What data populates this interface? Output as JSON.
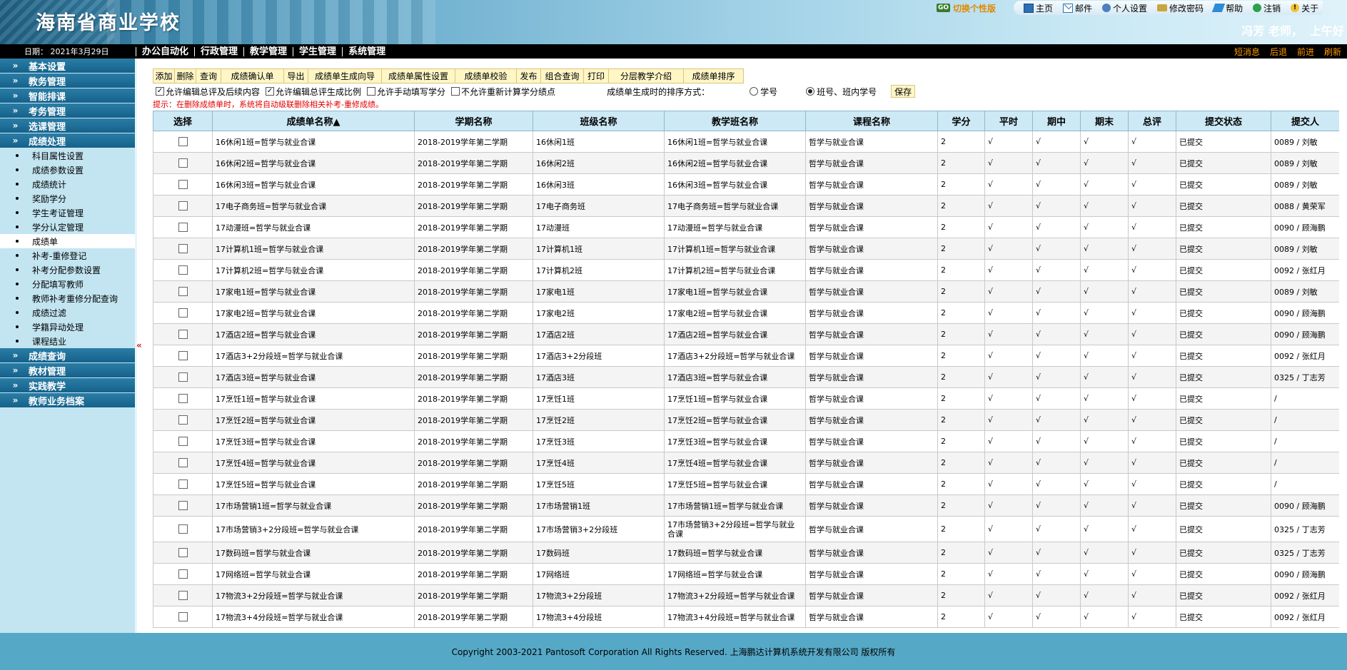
{
  "header": {
    "school_title": "海南省商业学校",
    "switch_badge": "GO",
    "switch_label": "切换个性版",
    "greeting_name": "冯芳 老师，",
    "greeting_time": "上午好"
  },
  "topnav": [
    {
      "icon": "home-icon",
      "label": "主页"
    },
    {
      "icon": "mail-icon",
      "label": "邮件"
    },
    {
      "icon": "user-settings-icon",
      "label": "个人设置"
    },
    {
      "icon": "key-icon",
      "label": "修改密码"
    },
    {
      "icon": "help-icon",
      "label": "帮助"
    },
    {
      "icon": "logout-icon",
      "label": "注销"
    },
    {
      "icon": "info-icon",
      "label": "关于"
    }
  ],
  "menubar": {
    "date": "日期： 2021年3月29日",
    "items": [
      "办公自动化",
      "行政管理",
      "教学管理",
      "学生管理",
      "系统管理"
    ],
    "right": [
      "短消息",
      "后退",
      "前进",
      "刷新"
    ]
  },
  "sidebar": {
    "groups_top": [
      "基本设置",
      "教务管理",
      "智能排课",
      "考务管理",
      "选课管理",
      "成绩处理"
    ],
    "subitems": [
      "科目属性设置",
      "成绩参数设置",
      "成绩统计",
      "奖励学分",
      "学生考证管理",
      "学分认定管理",
      "成绩单",
      "补考-重修登记",
      "补考分配参数设置",
      "分配填写教师",
      "教师补考重修分配查询",
      "成绩过滤",
      "学籍异动处理",
      "课程结业"
    ],
    "active_sub": 6,
    "groups_bottom": [
      "成绩查询",
      "教材管理",
      "实践教学",
      "教师业务档案"
    ],
    "collapse": "«"
  },
  "toolbar": {
    "buttons": [
      "添加",
      "删除",
      "查询",
      "成绩确认单",
      "导出",
      "成绩单生成向导",
      "成绩单属性设置",
      "成绩单校验",
      "发布",
      "组合查询",
      "打印",
      "分层教学介绍",
      "成绩单排序"
    ]
  },
  "options": {
    "cb1": "允许编辑总评及后续内容",
    "cb2": "允许编辑总评生成比例",
    "cb3": "允许手动填写学分",
    "cb4": "不允许重新计算学分绩点",
    "sort_label": "成绩单生成时的排序方式：",
    "radio1": "学号",
    "radio2": "班号、班内学号",
    "save": "保存",
    "tip": "提示：在删除成绩单时，系统将自动级联删除相关补考-重修成绩。"
  },
  "table": {
    "headers": [
      "选择",
      "成绩单名称▲",
      "学期名称",
      "班级名称",
      "教学班名称",
      "课程名称",
      "学分",
      "平时",
      "期中",
      "期末",
      "总评",
      "提交状态",
      "提交人"
    ],
    "rows": [
      [
        "16休闲1班=哲学与就业合课",
        "2018-2019学年第二学期",
        "16休闲1班",
        "16休闲1班=哲学与就业合课",
        "哲学与就业合课",
        "2",
        "√",
        "√",
        "√",
        "√",
        "已提交",
        "0089 / 刘敏"
      ],
      [
        "16休闲2班=哲学与就业合课",
        "2018-2019学年第二学期",
        "16休闲2班",
        "16休闲2班=哲学与就业合课",
        "哲学与就业合课",
        "2",
        "√",
        "√",
        "√",
        "√",
        "已提交",
        "0089 / 刘敏"
      ],
      [
        "16休闲3班=哲学与就业合课",
        "2018-2019学年第二学期",
        "16休闲3班",
        "16休闲3班=哲学与就业合课",
        "哲学与就业合课",
        "2",
        "√",
        "√",
        "√",
        "√",
        "已提交",
        "0089 / 刘敏"
      ],
      [
        "17电子商务班=哲学与就业合课",
        "2018-2019学年第二学期",
        "17电子商务班",
        "17电子商务班=哲学与就业合课",
        "哲学与就业合课",
        "2",
        "√",
        "√",
        "√",
        "√",
        "已提交",
        "0088 / 黄荣军"
      ],
      [
        "17动漫班=哲学与就业合课",
        "2018-2019学年第二学期",
        "17动漫班",
        "17动漫班=哲学与就业合课",
        "哲学与就业合课",
        "2",
        "√",
        "√",
        "√",
        "√",
        "已提交",
        "0090 / 顾海鹏"
      ],
      [
        "17计算机1班=哲学与就业合课",
        "2018-2019学年第二学期",
        "17计算机1班",
        "17计算机1班=哲学与就业合课",
        "哲学与就业合课",
        "2",
        "√",
        "√",
        "√",
        "√",
        "已提交",
        "0089 / 刘敏"
      ],
      [
        "17计算机2班=哲学与就业合课",
        "2018-2019学年第二学期",
        "17计算机2班",
        "17计算机2班=哲学与就业合课",
        "哲学与就业合课",
        "2",
        "√",
        "√",
        "√",
        "√",
        "已提交",
        "0092 / 张红月"
      ],
      [
        "17家电1班=哲学与就业合课",
        "2018-2019学年第二学期",
        "17家电1班",
        "17家电1班=哲学与就业合课",
        "哲学与就业合课",
        "2",
        "√",
        "√",
        "√",
        "√",
        "已提交",
        "0089 / 刘敏"
      ],
      [
        "17家电2班=哲学与就业合课",
        "2018-2019学年第二学期",
        "17家电2班",
        "17家电2班=哲学与就业合课",
        "哲学与就业合课",
        "2",
        "√",
        "√",
        "√",
        "√",
        "已提交",
        "0090 / 顾海鹏"
      ],
      [
        "17酒店2班=哲学与就业合课",
        "2018-2019学年第二学期",
        "17酒店2班",
        "17酒店2班=哲学与就业合课",
        "哲学与就业合课",
        "2",
        "√",
        "√",
        "√",
        "√",
        "已提交",
        "0090 / 顾海鹏"
      ],
      [
        "17酒店3+2分段班=哲学与就业合课",
        "2018-2019学年第二学期",
        "17酒店3+2分段班",
        "17酒店3+2分段班=哲学与就业合课",
        "哲学与就业合课",
        "2",
        "√",
        "√",
        "√",
        "√",
        "已提交",
        "0092 / 张红月"
      ],
      [
        "17酒店3班=哲学与就业合课",
        "2018-2019学年第二学期",
        "17酒店3班",
        "17酒店3班=哲学与就业合课",
        "哲学与就业合课",
        "2",
        "√",
        "√",
        "√",
        "√",
        "已提交",
        "0325 / 丁志芳"
      ],
      [
        "17烹饪1班=哲学与就业合课",
        "2018-2019学年第二学期",
        "17烹饪1班",
        "17烹饪1班=哲学与就业合课",
        "哲学与就业合课",
        "2",
        "√",
        "√",
        "√",
        "√",
        "已提交",
        "/"
      ],
      [
        "17烹饪2班=哲学与就业合课",
        "2018-2019学年第二学期",
        "17烹饪2班",
        "17烹饪2班=哲学与就业合课",
        "哲学与就业合课",
        "2",
        "√",
        "√",
        "√",
        "√",
        "已提交",
        "/"
      ],
      [
        "17烹饪3班=哲学与就业合课",
        "2018-2019学年第二学期",
        "17烹饪3班",
        "17烹饪3班=哲学与就业合课",
        "哲学与就业合课",
        "2",
        "√",
        "√",
        "√",
        "√",
        "已提交",
        "/"
      ],
      [
        "17烹饪4班=哲学与就业合课",
        "2018-2019学年第二学期",
        "17烹饪4班",
        "17烹饪4班=哲学与就业合课",
        "哲学与就业合课",
        "2",
        "√",
        "√",
        "√",
        "√",
        "已提交",
        "/"
      ],
      [
        "17烹饪5班=哲学与就业合课",
        "2018-2019学年第二学期",
        "17烹饪5班",
        "17烹饪5班=哲学与就业合课",
        "哲学与就业合课",
        "2",
        "√",
        "√",
        "√",
        "√",
        "已提交",
        "/"
      ],
      [
        "17市场营销1班=哲学与就业合课",
        "2018-2019学年第二学期",
        "17市场营销1班",
        "17市场营销1班=哲学与就业合课",
        "哲学与就业合课",
        "2",
        "√",
        "√",
        "√",
        "√",
        "已提交",
        "0090 / 顾海鹏"
      ],
      [
        "17市场营销3+2分段班=哲学与就业合课",
        "2018-2019学年第二学期",
        "17市场营销3+2分段班",
        "17市场营销3+2分段班=哲学与就业合课",
        "哲学与就业合课",
        "2",
        "√",
        "√",
        "√",
        "√",
        "已提交",
        "0325 / 丁志芳"
      ],
      [
        "17数码班=哲学与就业合课",
        "2018-2019学年第二学期",
        "17数码班",
        "17数码班=哲学与就业合课",
        "哲学与就业合课",
        "2",
        "√",
        "√",
        "√",
        "√",
        "已提交",
        "0325 / 丁志芳"
      ],
      [
        "17网络班=哲学与就业合课",
        "2018-2019学年第二学期",
        "17网络班",
        "17网络班=哲学与就业合课",
        "哲学与就业合课",
        "2",
        "√",
        "√",
        "√",
        "√",
        "已提交",
        "0090 / 顾海鹏"
      ],
      [
        "17物流3+2分段班=哲学与就业合课",
        "2018-2019学年第二学期",
        "17物流3+2分段班",
        "17物流3+2分段班=哲学与就业合课",
        "哲学与就业合课",
        "2",
        "√",
        "√",
        "√",
        "√",
        "已提交",
        "0092 / 张红月"
      ],
      [
        "17物流3+4分段班=哲学与就业合课",
        "2018-2019学年第二学期",
        "17物流3+4分段班",
        "17物流3+4分段班=哲学与就业合课",
        "哲学与就业合课",
        "2",
        "√",
        "√",
        "√",
        "√",
        "已提交",
        "0092 / 张红月"
      ]
    ]
  },
  "footer": {
    "copyright": "Copyright 2003-2021 Pantosoft Corporation All Rights Reserved.  上海鹏达计算机系统开发有限公司  版权所有"
  }
}
